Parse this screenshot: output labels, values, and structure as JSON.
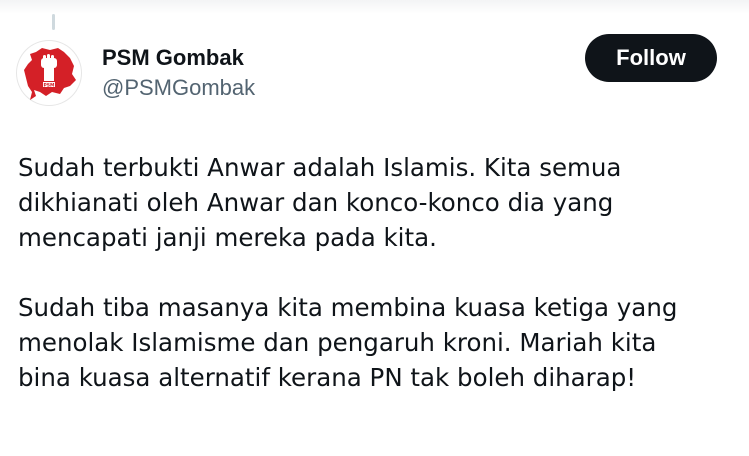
{
  "author": {
    "display_name": "PSM Gombak",
    "handle": "@PSMGombak",
    "avatar": {
      "icon": "raised-fist-map-logo-icon",
      "background_color": "#ffffff",
      "logo_color": "#d42027"
    }
  },
  "follow_button": {
    "label": "Follow",
    "background_color": "#0f1419",
    "text_color": "#ffffff"
  },
  "tweet": {
    "paragraphs": [
      {
        "lines": [
          "Sudah terbukti Anwar adalah Islamis. Kita semua",
          "dikhianati oleh Anwar dan konco-konco dia yang",
          "mencapati janji mereka pada kita."
        ]
      },
      {
        "lines": [
          "Sudah tiba masanya kita membina kuasa ketiga yang",
          "menolak Islamisme dan pengaruh kroni. Mariah kita",
          "bina kuasa alternatif kerana PN tak boleh diharap!"
        ]
      }
    ]
  },
  "colors": {
    "text_primary": "#0f1419",
    "text_secondary": "#536471"
  }
}
